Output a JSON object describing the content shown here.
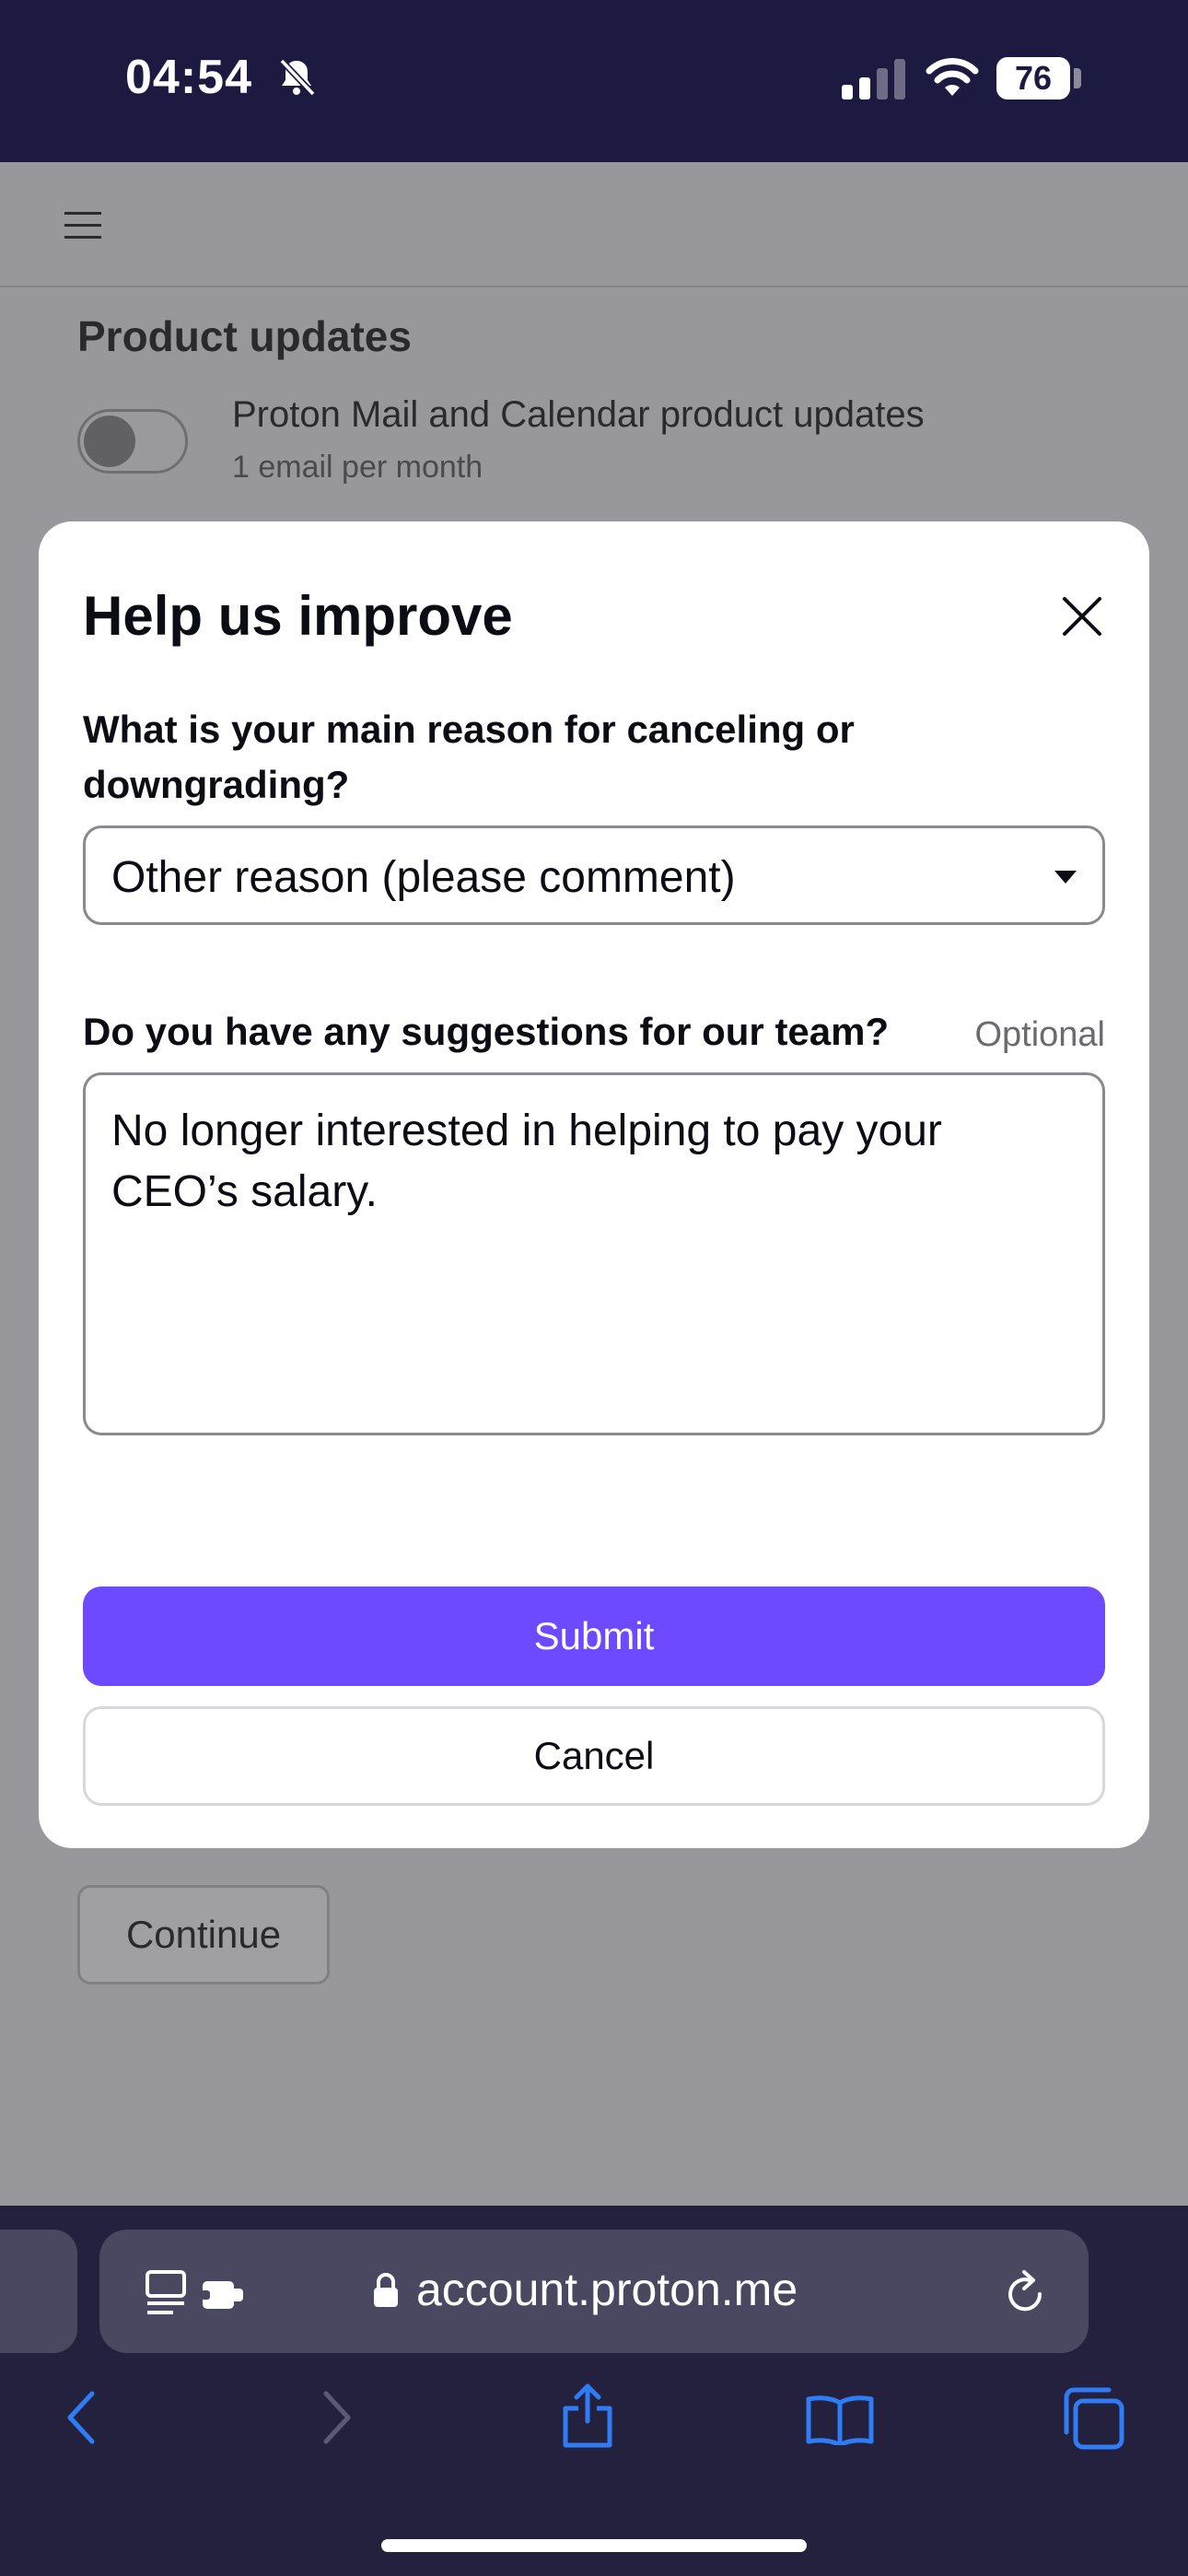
{
  "status_bar": {
    "time": "04:54",
    "battery": "76",
    "icons": [
      "bell-slash-icon",
      "signal-icon",
      "wifi-icon",
      "battery-icon"
    ]
  },
  "background_page": {
    "menu_icon": "hamburger-icon",
    "section_title": "Product updates",
    "preference": {
      "label": "Proton Mail and Calendar product updates",
      "sublabel": "1 email per month",
      "enabled": false
    },
    "continue_label": "Continue"
  },
  "modal": {
    "title": "Help us improve",
    "question_reason": "What is your main reason for canceling or downgrading?",
    "reason_selected": "Other reason (please comment)",
    "question_suggestions": "Do you have any suggestions for our team?",
    "optional_label": "Optional",
    "suggestion_value": "No longer interested in helping to pay your CEO’s salary.",
    "submit_label": "Submit",
    "cancel_label": "Cancel",
    "accent_color": "#6d4aff"
  },
  "browser": {
    "url": "account.proton.me",
    "toolbar_icons": [
      "back-icon",
      "forward-icon",
      "share-icon",
      "bookmarks-icon",
      "tabs-icon"
    ],
    "accent_color": "#2f7cf6"
  }
}
